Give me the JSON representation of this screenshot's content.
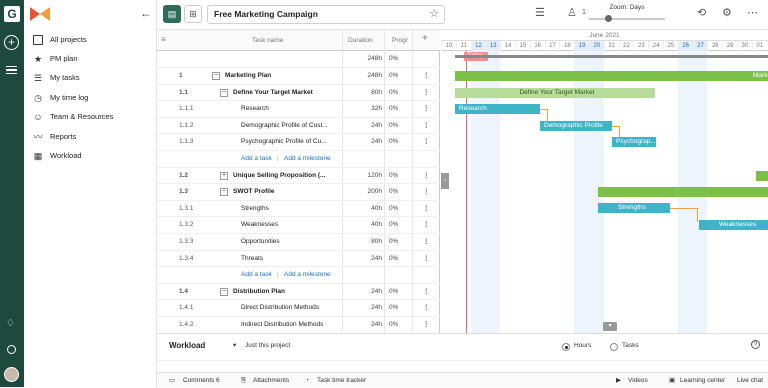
{
  "app": {
    "project_title": "Free Marketing Campaign",
    "zoom_label": "Zoom: Days",
    "resources_count": "1",
    "rail_logo": "G"
  },
  "sidebar": {
    "items": [
      {
        "label": "All projects",
        "icon": "folder-icon"
      },
      {
        "label": "PM plan",
        "icon": "star-icon"
      },
      {
        "label": "My tasks",
        "icon": "tasks-icon"
      },
      {
        "label": "My time log",
        "icon": "clock-icon"
      },
      {
        "label": "Team & Resources",
        "icon": "team-icon"
      },
      {
        "label": "Reports",
        "icon": "chart-icon"
      },
      {
        "label": "Workload",
        "icon": "grid-icon"
      }
    ]
  },
  "grid": {
    "headers": {
      "name": "Task name",
      "duration": "Duration",
      "progress": "Progr"
    },
    "summary": {
      "duration": "248h",
      "progress": "0%"
    },
    "rows": [
      {
        "num": "1",
        "name": "Marketing Plan",
        "dur": "248h",
        "prog": "0%",
        "level": 0,
        "toggle": "−",
        "bold": true
      },
      {
        "num": "1.1",
        "name": "Define Your Target Market",
        "dur": "80h",
        "prog": "0%",
        "level": 1,
        "toggle": "−",
        "bold": true
      },
      {
        "num": "1.1.1",
        "name": "Research",
        "dur": "32h",
        "prog": "0%",
        "level": 2
      },
      {
        "num": "1.1.2",
        "name": "Demographic Profile of Cust...",
        "dur": "24h",
        "prog": "0%",
        "level": 2
      },
      {
        "num": "1.1.3",
        "name": "Psychographic Profile of Cu...",
        "dur": "24h",
        "prog": "0%",
        "level": 2
      },
      {
        "add_task": "Add a task",
        "add_milestone": "Add a milestone"
      },
      {
        "num": "1.2",
        "name": "Unique Selling Proposition (...",
        "dur": "120h",
        "prog": "0%",
        "level": 1,
        "toggle": "+",
        "bold": true
      },
      {
        "num": "1.3",
        "name": "SWOT Profile",
        "dur": "200h",
        "prog": "0%",
        "level": 1,
        "toggle": "−",
        "bold": true
      },
      {
        "num": "1.3.1",
        "name": "Strengths",
        "dur": "40h",
        "prog": "0%",
        "level": 2
      },
      {
        "num": "1.3.2",
        "name": "Weaknesses",
        "dur": "40h",
        "prog": "0%",
        "level": 2
      },
      {
        "num": "1.3.3",
        "name": "Opportunities",
        "dur": "80h",
        "prog": "0%",
        "level": 2
      },
      {
        "num": "1.3.4",
        "name": "Threats",
        "dur": "24h",
        "prog": "0%",
        "level": 2
      },
      {
        "add_task": "Add a task",
        "add_milestone": "Add a milestone"
      },
      {
        "num": "1.4",
        "name": "Distribution Plan",
        "dur": "24h",
        "prog": "0%",
        "level": 1,
        "toggle": "−",
        "bold": true
      },
      {
        "num": "1.4.1",
        "name": "Direct Distribution Methods",
        "dur": "24h",
        "prog": "0%",
        "level": 2
      },
      {
        "num": "1.4.2",
        "name": "Indirect Distribution Methods",
        "dur": "24h",
        "prog": "0%",
        "level": 2
      }
    ]
  },
  "gantt": {
    "month": "June 2021",
    "days": [
      "10",
      "11",
      "12",
      "13",
      "14",
      "15",
      "16",
      "17",
      "18",
      "19",
      "20",
      "21",
      "22",
      "23",
      "24",
      "25",
      "26",
      "27",
      "28",
      "29",
      "30",
      "01"
    ],
    "weekend_days": [
      "12",
      "13",
      "19",
      "20",
      "26",
      "27"
    ],
    "today_label": "Today",
    "bars": {
      "marketing_plan": "Market",
      "target_market": "Define Your Target Market",
      "research": "Research",
      "demographic": "Demographic Profile",
      "psychographic": "Psychograp...",
      "strengths": "Strengths",
      "weaknesses": "Weaknesses"
    }
  },
  "workload": {
    "title": "Workload",
    "filter": "Just this project",
    "option_hours": "Hours",
    "option_tasks": "Tasks"
  },
  "footer": {
    "comments": "Comments",
    "comments_count": "6",
    "attachments": "Attachments",
    "tracker": "Task time tracker",
    "videos": "Videos",
    "learning": "Learning center",
    "chat": "Live chat"
  },
  "colors": {
    "rail": "#1e4a3e",
    "accent": "#2e6b59",
    "bar_green": "#7cc04a",
    "bar_teal": "#3fb4c9",
    "today": "#e26a6a",
    "link": "#1a6fc4"
  }
}
